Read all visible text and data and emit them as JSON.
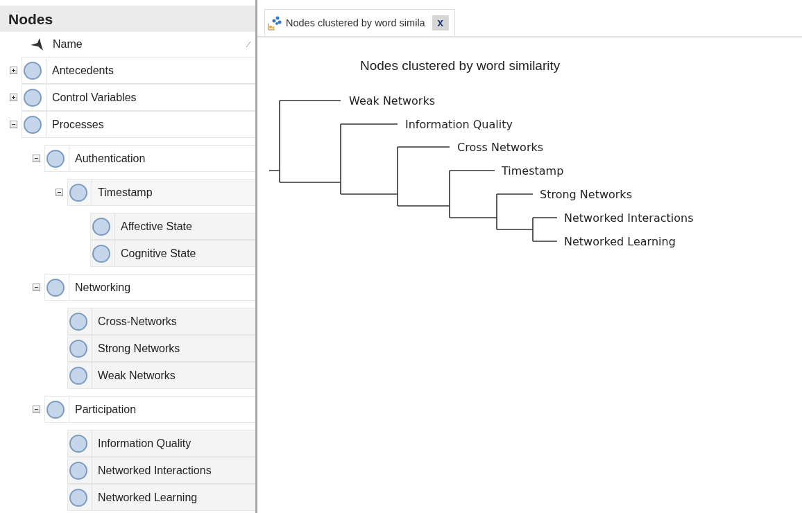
{
  "panel": {
    "title": "Nodes",
    "column": "Name"
  },
  "tree": [
    {
      "label": "Antecedents",
      "expanded": false
    },
    {
      "label": "Control Variables",
      "expanded": false
    },
    {
      "label": "Processes",
      "expanded": true,
      "children": [
        {
          "label": "Authentication",
          "expanded": true,
          "children": [
            {
              "label": "Timestamp",
              "expanded": true,
              "children": [
                {
                  "label": "Affective State"
                },
                {
                  "label": "Cognitive State"
                }
              ]
            }
          ]
        },
        {
          "label": "Networking",
          "expanded": true,
          "children": [
            {
              "label": "Cross-Networks"
            },
            {
              "label": "Strong Networks"
            },
            {
              "label": "Weak Networks"
            }
          ]
        },
        {
          "label": "Participation",
          "expanded": true,
          "children": [
            {
              "label": "Information Quality"
            },
            {
              "label": "Networked Interactions"
            },
            {
              "label": "Networked Learning"
            }
          ]
        }
      ]
    }
  ],
  "tab": {
    "label": "Nodes clustered by word simila",
    "close": "x"
  },
  "dendrogram": {
    "title": "Nodes clustered by word similarity",
    "leaves": [
      "Weak Networks",
      "Information Quality",
      "Cross Networks",
      "Timestamp",
      "Strong Networks",
      "Networked Interactions",
      "Networked Learning"
    ]
  }
}
